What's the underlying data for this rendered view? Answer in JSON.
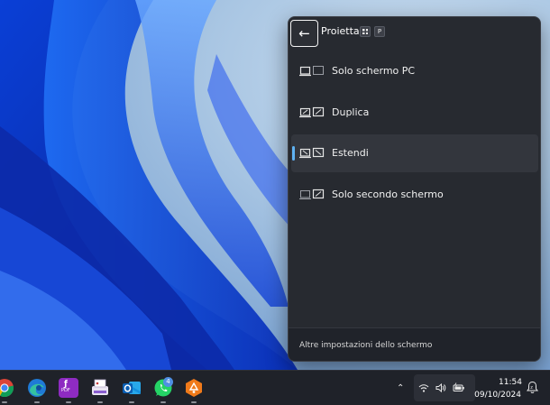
{
  "flyout": {
    "title": "Proietta",
    "shortcut_key": "P",
    "options": [
      {
        "label": "Solo schermo PC",
        "icon": "pc-screen-only-icon",
        "selected": false
      },
      {
        "label": "Duplica",
        "icon": "duplicate-icon",
        "selected": false
      },
      {
        "label": "Estendi",
        "icon": "extend-icon",
        "selected": true
      },
      {
        "label": "Solo secondo schermo",
        "icon": "second-screen-only-icon",
        "selected": false
      }
    ],
    "footer_link": "Altre impostazioni dello schermo"
  },
  "taskbar": {
    "apps": [
      {
        "name": "chrome-icon"
      },
      {
        "name": "edge-icon"
      },
      {
        "name": "pdf-app-icon",
        "label": "PDF"
      },
      {
        "name": "printer-app-icon"
      },
      {
        "name": "outlook-icon"
      },
      {
        "name": "whatsapp-icon",
        "badge": "4"
      },
      {
        "name": "orange-app-icon"
      }
    ],
    "tray": [
      "wifi-icon",
      "volume-icon",
      "battery-icon"
    ],
    "time": "11:54",
    "date": "09/10/2024"
  },
  "colors": {
    "accent": "#5fb2f2",
    "flyout_bg": "#272a30",
    "taskbar_bg": "#1f2229"
  }
}
